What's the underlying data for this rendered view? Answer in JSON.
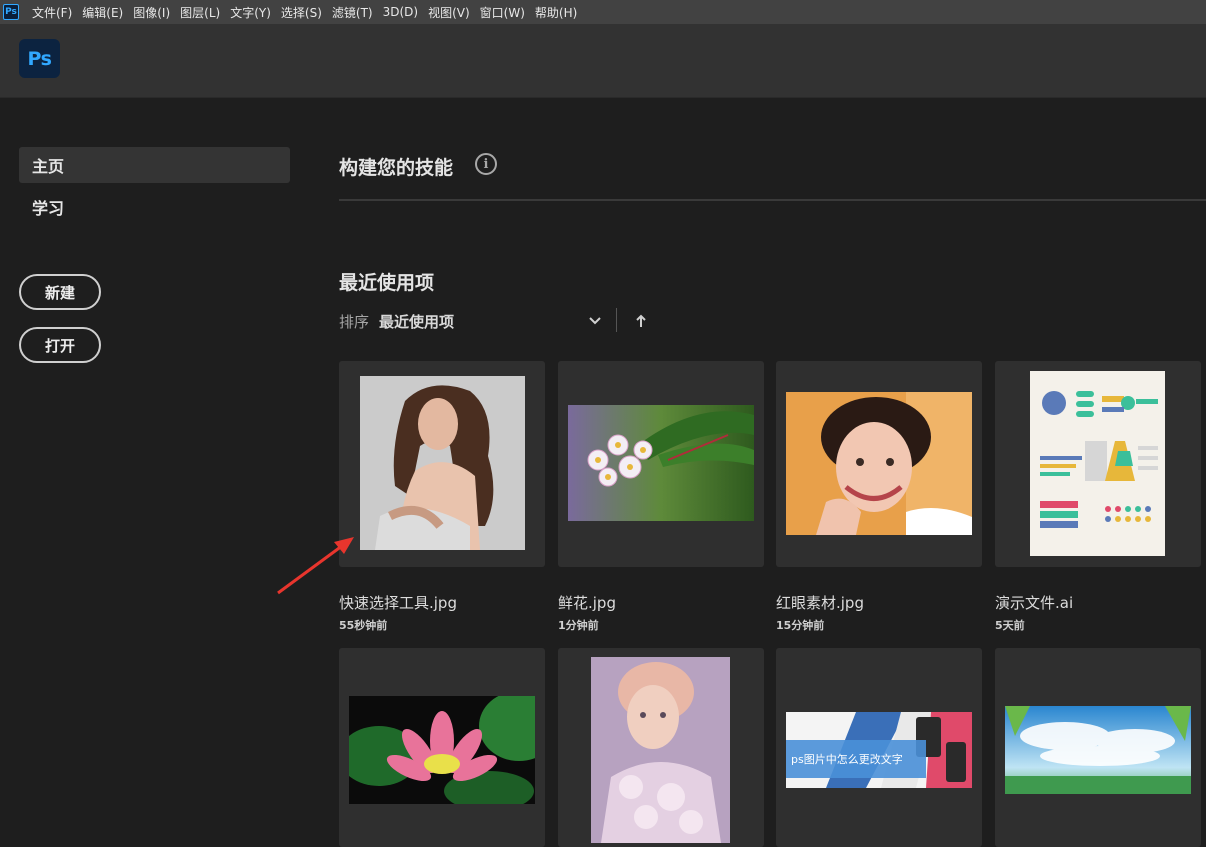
{
  "menubar": {
    "app_icon": "Ps",
    "items": [
      "文件(F)",
      "编辑(E)",
      "图像(I)",
      "图层(L)",
      "文字(Y)",
      "选择(S)",
      "滤镜(T)",
      "3D(D)",
      "视图(V)",
      "窗口(W)",
      "帮助(H)"
    ]
  },
  "header": {
    "logo": "Ps"
  },
  "sidebar": {
    "nav": [
      {
        "label": "主页",
        "active": true
      },
      {
        "label": "学习",
        "active": false
      }
    ],
    "new_button": "新建",
    "open_button": "打开"
  },
  "main": {
    "skills_title": "构建您的技能",
    "info_icon": "i",
    "recent_title": "最近使用项",
    "sort_label": "排序",
    "sort_value": "最近使用项",
    "files": [
      {
        "name": "快速选择工具.jpg",
        "time": "55秒钟前",
        "thumb": "woman-portrait"
      },
      {
        "name": "鲜花.jpg",
        "time": "1分钟前",
        "thumb": "flower"
      },
      {
        "name": "红眼素材.jpg",
        "time": "15分钟前",
        "thumb": "smiling-woman"
      },
      {
        "name": "演示文件.ai",
        "time": "5天前",
        "thumb": "infographic"
      },
      {
        "name": "",
        "time": "",
        "thumb": "lotus"
      },
      {
        "name": "",
        "time": "",
        "thumb": "painted-portrait"
      },
      {
        "name": "",
        "time": "",
        "thumb": "phone-banner",
        "banner_text": "ps图片中怎么更改文字"
      },
      {
        "name": "",
        "time": "",
        "thumb": "sky-landscape"
      }
    ]
  },
  "colors": {
    "ps_blue": "#31a8ff",
    "annotation_red": "#e8352d"
  }
}
